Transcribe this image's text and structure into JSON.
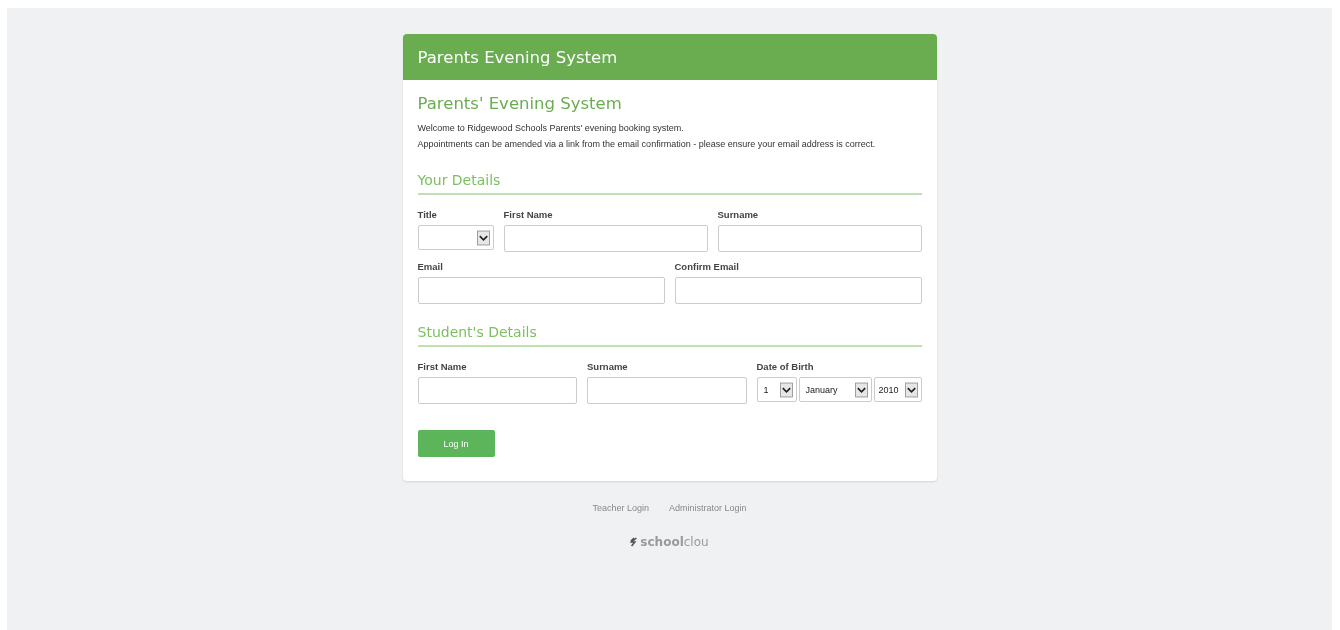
{
  "header": {
    "title": "Parents Evening System"
  },
  "intro": {
    "heading": "Parents' Evening System",
    "lines": [
      "Welcome to Ridgewood Schools Parents' evening booking system.",
      "Appointments can be amended via a link from the email confirmation - please ensure your email address is correct."
    ]
  },
  "sections": [
    {
      "heading": "Your Details",
      "rows": [
        [
          {
            "kind": "select",
            "label": "Title"
          },
          {
            "kind": "text",
            "label": "First Name"
          },
          {
            "kind": "text",
            "label": "Surname"
          }
        ],
        [
          {
            "kind": "text",
            "label": "Email"
          },
          {
            "kind": "text",
            "label": "Confirm Email"
          }
        ]
      ]
    },
    {
      "heading": "Student's Details",
      "rows": [
        [
          {
            "kind": "text",
            "label": "First Name"
          },
          {
            "kind": "text",
            "label": "Surname"
          },
          {
            "kind": "date",
            "label": "Date of Birth",
            "parts": [
              "1",
              "January",
              "2010"
            ]
          }
        ]
      ]
    }
  ],
  "submit": {
    "label": "Log In"
  },
  "footer_links": [
    "Teacher Login",
    "Administrator Login"
  ],
  "logo": "**school**clou"
}
